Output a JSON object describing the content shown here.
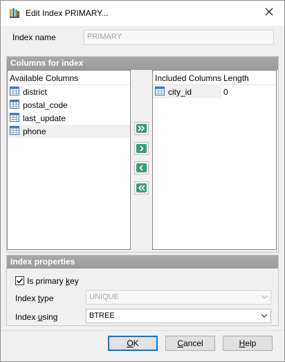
{
  "window": {
    "title": "Edit Index PRIMARY...",
    "app_icon": "database-index-icon",
    "close_icon": "close-icon"
  },
  "index_name": {
    "label": "Index name",
    "value": "PRIMARY"
  },
  "columns_section": {
    "header": "Columns for index",
    "available": {
      "header": "Available Columns",
      "items": [
        {
          "label": "district",
          "icon": "table-column-icon"
        },
        {
          "label": "postal_code",
          "icon": "table-column-icon"
        },
        {
          "label": "last_update",
          "icon": "table-column-icon"
        },
        {
          "label": "phone",
          "icon": "table-column-icon",
          "selected": true
        }
      ]
    },
    "included": {
      "header_column": "Included Columns",
      "header_length": "Length",
      "items": [
        {
          "label": "city_id",
          "length": "0",
          "icon": "table-column-icon"
        }
      ]
    },
    "arrow_buttons": [
      "move-all-right-icon",
      "move-right-icon",
      "move-left-icon",
      "move-all-left-icon"
    ]
  },
  "properties_section": {
    "header": "Index properties",
    "primary_key": {
      "label_pre": "Is primary ",
      "label_ul": "k",
      "label_post": "ey",
      "checked": true
    },
    "index_type": {
      "label_pre": "Index ",
      "label_ul": "t",
      "label_post": "ype",
      "value": "UNIQUE",
      "disabled": true
    },
    "index_using": {
      "label_pre": "Index ",
      "label_ul": "u",
      "label_post": "sing",
      "value": "BTREE"
    }
  },
  "buttons": {
    "ok": {
      "ul": "O",
      "rest": "K"
    },
    "cancel": {
      "ul": "C",
      "rest": "ancel"
    },
    "help": {
      "ul": "H",
      "rest": "elp"
    }
  },
  "colors": {
    "accent_green": "#3a9d75",
    "section_header": "#a0a0a0",
    "focus_blue": "#0078d7"
  }
}
